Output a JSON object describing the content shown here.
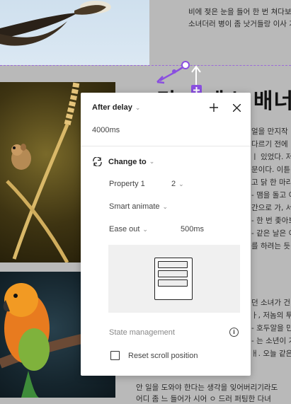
{
  "article": {
    "lines_top": [
      "비에 젖은 눈을 들어 한 번 쳐다보았",
      "소녀더러 병이 좀 낫거들랑 이사 가기"
    ],
    "big_title": "ㅋ긴 ㅎ게스 배너",
    "lines_mid": [
      "얼을 만지작",
      "다르기 전에",
      "ㅣ 있었다. 저",
      "문이다. 이튿",
      "고 닭 한 마리",
      "- 맴을 돌고 이",
      "간으로 가, 서",
      "- 한 번 좇아보",
      "- 같은 날은 이",
      "를 하려는 듯"
    ],
    "lines_bottom": [
      "던 소녀가 건",
      "ㅏ, 저놈의 투",
      "- 호두알을 만",
      "- 는 소년이 가",
      "ㅐ. 오늘 같은",
      "안 일을 도와야 한다는 생각을 잊어버리기라도",
      "어디 좀 느 들어가 시어 ㅇ 드러 퍼팅한 다녀"
    ]
  },
  "panel": {
    "trigger": "After delay",
    "delay": "4000ms",
    "action": "Change to",
    "property_label": "Property 1",
    "property_value": "2",
    "animation": "Smart animate",
    "easing": "Ease out",
    "duration": "500ms",
    "state_management": "State management",
    "reset_scroll": "Reset scroll position"
  },
  "icons": {
    "add": "plus-icon",
    "close": "close-icon",
    "swap": "swap-arrows-icon",
    "info": "info-icon",
    "chevron": "chevron-down-icon"
  },
  "colors": {
    "prototype_connector": "#8a4fe0",
    "canvas_bg": "#b9b9b9"
  }
}
